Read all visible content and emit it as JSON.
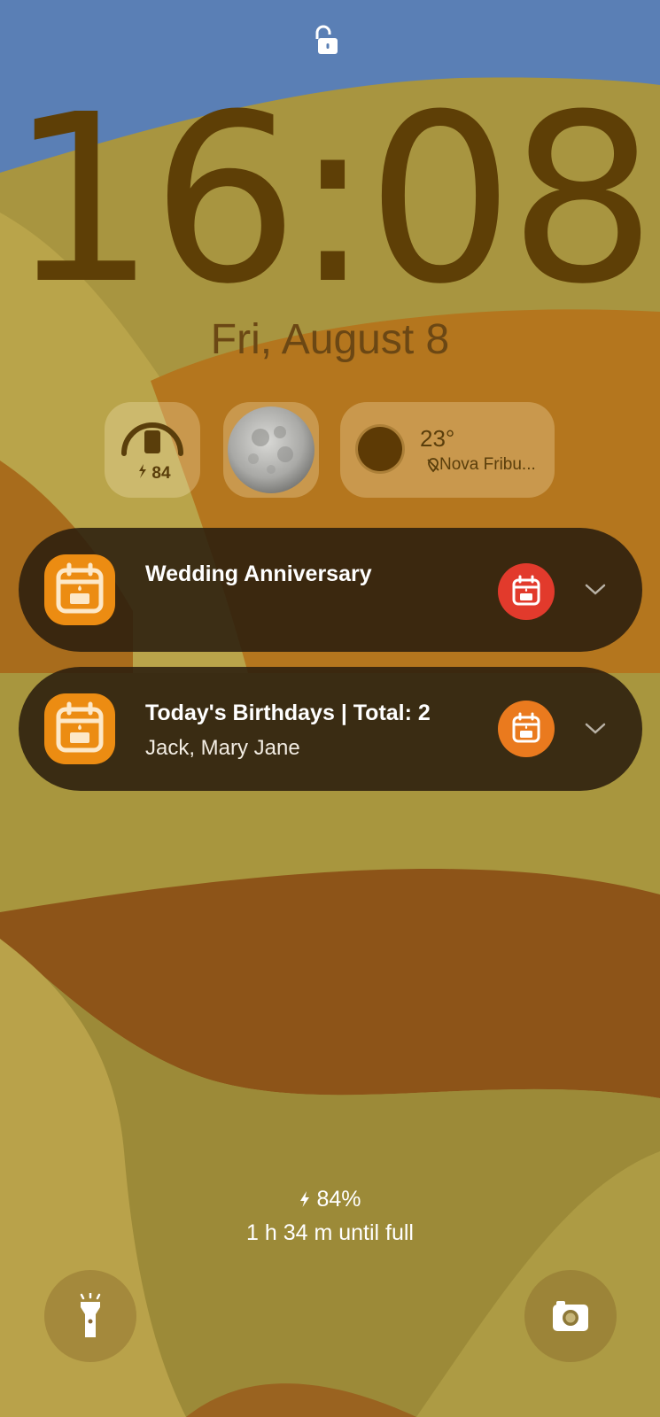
{
  "lock_screen": {
    "clock": "16:08",
    "date": "Fri, August 8"
  },
  "widgets": {
    "battery": {
      "level": "84",
      "icon": "phone-battery-gauge"
    },
    "moon": {
      "icon": "moon-phase-full"
    },
    "weather": {
      "temperature": "23°",
      "location": "Nova Fribu...",
      "icon": "sun"
    }
  },
  "notifications": [
    {
      "app_icon": "birthday-calendar-icon",
      "title": "Wedding Anniversary",
      "text": "",
      "badge_color": "#e23a2c",
      "badge_icon": "birthday-calendar-icon"
    },
    {
      "app_icon": "birthday-calendar-icon",
      "title": "Today's Birthdays | Total: 2",
      "text": "Jack, Mary Jane",
      "badge_color": "#ea7a1e",
      "badge_icon": "birthday-calendar-icon"
    }
  ],
  "charging": {
    "percent": "84%",
    "time_until_full": "1 h 34 m until full"
  },
  "shortcuts": {
    "left": {
      "icon": "flashlight-icon"
    },
    "right": {
      "icon": "camera-icon"
    }
  },
  "colors": {
    "sky": "#5a7fb5",
    "clock_text": "#5e3f06",
    "notification_bg": "#2a1e0e",
    "app_icon_bg": "#ec8c12"
  }
}
